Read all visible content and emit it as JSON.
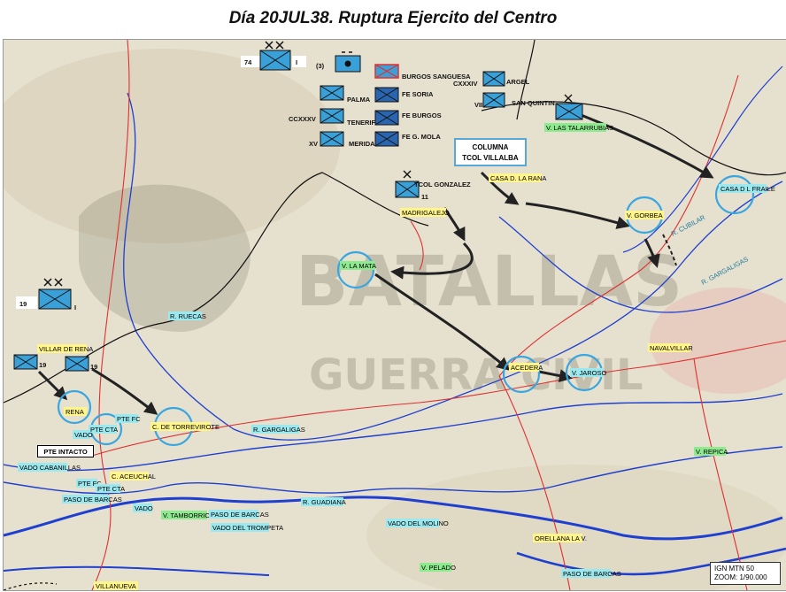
{
  "title": "Día 20JUL38. Ruptura Ejercito del Centro",
  "scale_box": {
    "line1": "IGN MTN 50",
    "line2": "ZOOM: 1/90.000"
  },
  "callout": {
    "line1": "COLUMNA",
    "line2": "TCOL VILLALBA"
  },
  "bridge_box": "PTE INTACTO",
  "watermark": {
    "line1": "BATALLAS",
    "line2": "GUERRA CIVIL"
  },
  "units": {
    "u74": {
      "number": "74",
      "size": "I"
    },
    "u3": {
      "number": "(3)"
    },
    "u19": {
      "number": "19",
      "size": "I"
    },
    "u19a": {
      "number": "19"
    },
    "u19b": {
      "number": "19"
    },
    "u11": {
      "number": "11"
    },
    "u_cxxxiv": "CXXXIV",
    "u_vii": "VII",
    "u_ccxxxv": "CCXXXV",
    "u_xv": "XV",
    "u_argel": "ARGEL",
    "u_sanquintin": "SAN QUINTIN",
    "u_burgos_sanguesa": "BURGOS SANGUESA",
    "u_palma": "PALMA",
    "u_fe_soria": "FE SORIA",
    "u_tenerife": "TENERIFE",
    "u_fe_burgos": "FE BURGOS",
    "u_merida": "MERIDA",
    "u_fe_gmola": "FE G. MOLA",
    "u_tcol_gonzalez": "TCOL GONZALEZ"
  },
  "places": {
    "las_talarrubias": "V. LAS TALARRUBIAS",
    "casa_rana": "CASA D. LA RANA",
    "madrigalejo": "MADRIGALEJO",
    "casa_fraile": "CASA D L FRAILE",
    "gorbea": "V. GORBEA",
    "r_cubilar": "R. CUBILAR",
    "r_gargaligas_ne": "R. GARGALIGAS",
    "v_la_mata": "V. LA MATA",
    "r_ruecas": "R. RUECAS",
    "villar_rena": "VILLAR DE RENA",
    "acedera": "ACEDERA",
    "v_jaroso": "V. JAROSO",
    "navalvillar": "NAVALVILLAR",
    "rena": "RENA",
    "pte_cta": "PTE CTA",
    "pte_fc": "PTE FC",
    "vado": "VADO",
    "c_torrevirote": "C. DE TORREVIROTE",
    "r_gargaligas_s": "R. GARGALIGAS",
    "vado_cabanillas": "VADO CABANILLAS",
    "pte_fc2": "PTE FC",
    "pte_cta2": "PTE CTA",
    "c_aceuchal": "C. ACEUCHAL",
    "paso_barcas": "PASO DE BARCAS",
    "vado2": "VADO",
    "v_tamborrio": "V. TAMBORRIO",
    "paso_barcas2": "PASO DE BARCAS",
    "vado_trompeta": "VADO DEL TROMPETA",
    "r_guadiana": "R. GUADIANA",
    "vado_molino": "VADO DEL MOLINO",
    "orellana": "ORELLANA LA V.",
    "v_repica": "V. REPICA",
    "v_pelado": "V. PELADO",
    "paso_barcas3": "PASO DE BARCAS",
    "villanueva": "VILLANUEVA"
  },
  "colors": {
    "river": "#1e3fd0",
    "road": "#e03030",
    "front_line": "#111111",
    "unit_fill": "#3aa0d8",
    "highlight_circle": "#38a6e0",
    "label_yellow": "#fff58a",
    "label_cyan": "#9be8ee",
    "label_green": "#8eea8e"
  }
}
